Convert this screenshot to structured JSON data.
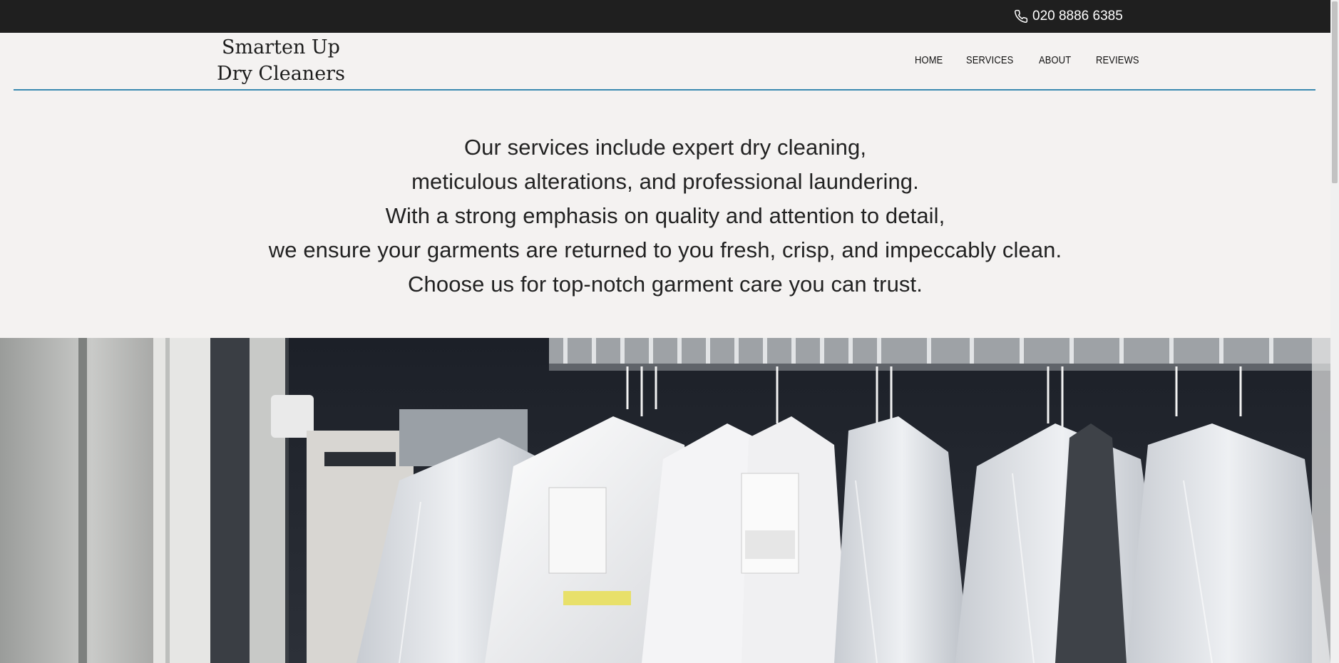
{
  "topbar": {
    "phone_icon": "phone-icon",
    "phone": "020 8886 6385"
  },
  "header": {
    "logo_line1": "Smarten Up",
    "logo_line2": "Dry Cleaners",
    "nav": [
      {
        "label": "HOME"
      },
      {
        "label": "SERVICES"
      },
      {
        "label": "ABOUT"
      },
      {
        "label": "REVIEWS"
      }
    ]
  },
  "intro": {
    "lines": [
      "Our services include expert dry cleaning,",
      "meticulous alterations, and professional laundering.",
      "With a strong emphasis on quality and attention to detail,",
      "we ensure your garments are returned to you fresh, crisp, and impeccably clean.",
      "Choose us for top-notch garment care you can trust."
    ]
  },
  "colors": {
    "topbar_bg": "#1f1f1f",
    "page_bg": "#f4f2f1",
    "header_rule": "#3a8ab0"
  }
}
